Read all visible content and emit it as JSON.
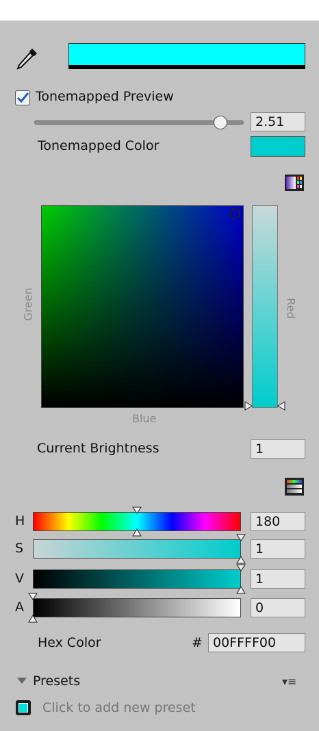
{
  "color": {
    "swatch": "#00ffff",
    "tonemapped_swatch": "#00cdcd"
  },
  "tonemap": {
    "checkbox_label": "Tonemapped Preview",
    "checked": true,
    "exposure": "2.51",
    "exposure_fraction": 0.89,
    "color_label": "Tonemapped Color"
  },
  "picker": {
    "y_axis": "Green",
    "x_axis": "Blue",
    "slider_axis": "Red"
  },
  "brightness": {
    "label": "Current Brightness",
    "value": "1"
  },
  "sliders": [
    {
      "label": "H",
      "value": "180",
      "fraction": 0.5
    },
    {
      "label": "S",
      "value": "1",
      "fraction": 1.0
    },
    {
      "label": "V",
      "value": "1",
      "fraction": 1.0
    },
    {
      "label": "A",
      "value": "0",
      "fraction": 0.0
    }
  ],
  "hex": {
    "label": "Hex Color",
    "hash": "#",
    "value": "00FFFF00"
  },
  "presets": {
    "title": "Presets",
    "menu_glyph": "▾≡",
    "add_text": "Click to add new preset"
  }
}
